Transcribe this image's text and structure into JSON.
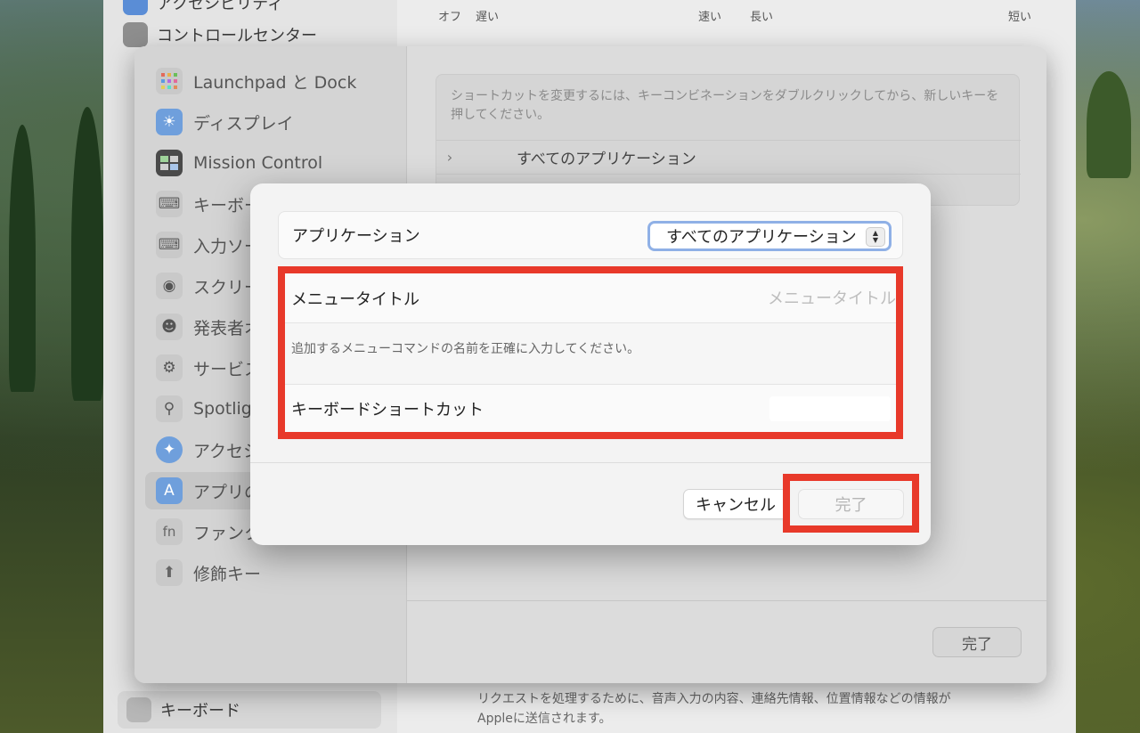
{
  "background_window": {
    "sidebar_items": [
      {
        "label": "アクセシビリティ"
      },
      {
        "label": "コントロールセンター"
      },
      {
        "label": "キーボード"
      }
    ],
    "slider_labels": {
      "off": "オフ",
      "slow": "遅い",
      "fast": "速い",
      "long": "長い",
      "short": "短い"
    },
    "note_line1": "リクエストを処理するために、音声入力の内容、連絡先情報、位置情報などの情報が",
    "note_line2": "Appleに送信されます。"
  },
  "settings_window": {
    "sidebar": {
      "items": [
        {
          "label": "Launchpad と Dock",
          "icon": "grid-icon"
        },
        {
          "label": "ディスプレイ",
          "icon": "sun-icon"
        },
        {
          "label": "Mission Control",
          "icon": "windows-icon"
        },
        {
          "label": "キーボード",
          "icon": "keyboard-icon"
        },
        {
          "label": "入力ソース",
          "icon": "keyboard-icon"
        },
        {
          "label": "スクリーンショット",
          "icon": "camera-icon"
        },
        {
          "label": "発表者オーバーレイ",
          "icon": "person-icon"
        },
        {
          "label": "サービス",
          "icon": "gear-icon"
        },
        {
          "label": "Spotlight",
          "icon": "search-icon"
        },
        {
          "label": "アクセシビリティ",
          "icon": "accessibility-icon"
        },
        {
          "label": "アプリのショートカット",
          "icon": "app-store-icon"
        },
        {
          "label": "ファンクションキー",
          "icon": "fn-icon"
        },
        {
          "label": "修飾キー",
          "icon": "arrow-up-icon"
        }
      ]
    },
    "hint": "ショートカットを変更するには、キーコンビネーションをダブルクリックしてから、新しいキーを押してください。",
    "all_apps_row": "すべてのアプリケーション",
    "done_label": "完了"
  },
  "sheet": {
    "application_label": "アプリケーション",
    "application_value": "すべてのアプリケーション",
    "menu_title_label": "メニュータイトル",
    "menu_title_placeholder": "メニュータイトル",
    "menu_title_value": "",
    "menu_hint": "追加するメニューコマンドの名前を正確に入力してください。",
    "shortcut_label": "キーボードショートカット",
    "cancel_label": "キャンセル",
    "done_label": "完了"
  },
  "colors": {
    "highlight_red": "#e8392a",
    "focus_ring": "#8fb0e6"
  }
}
